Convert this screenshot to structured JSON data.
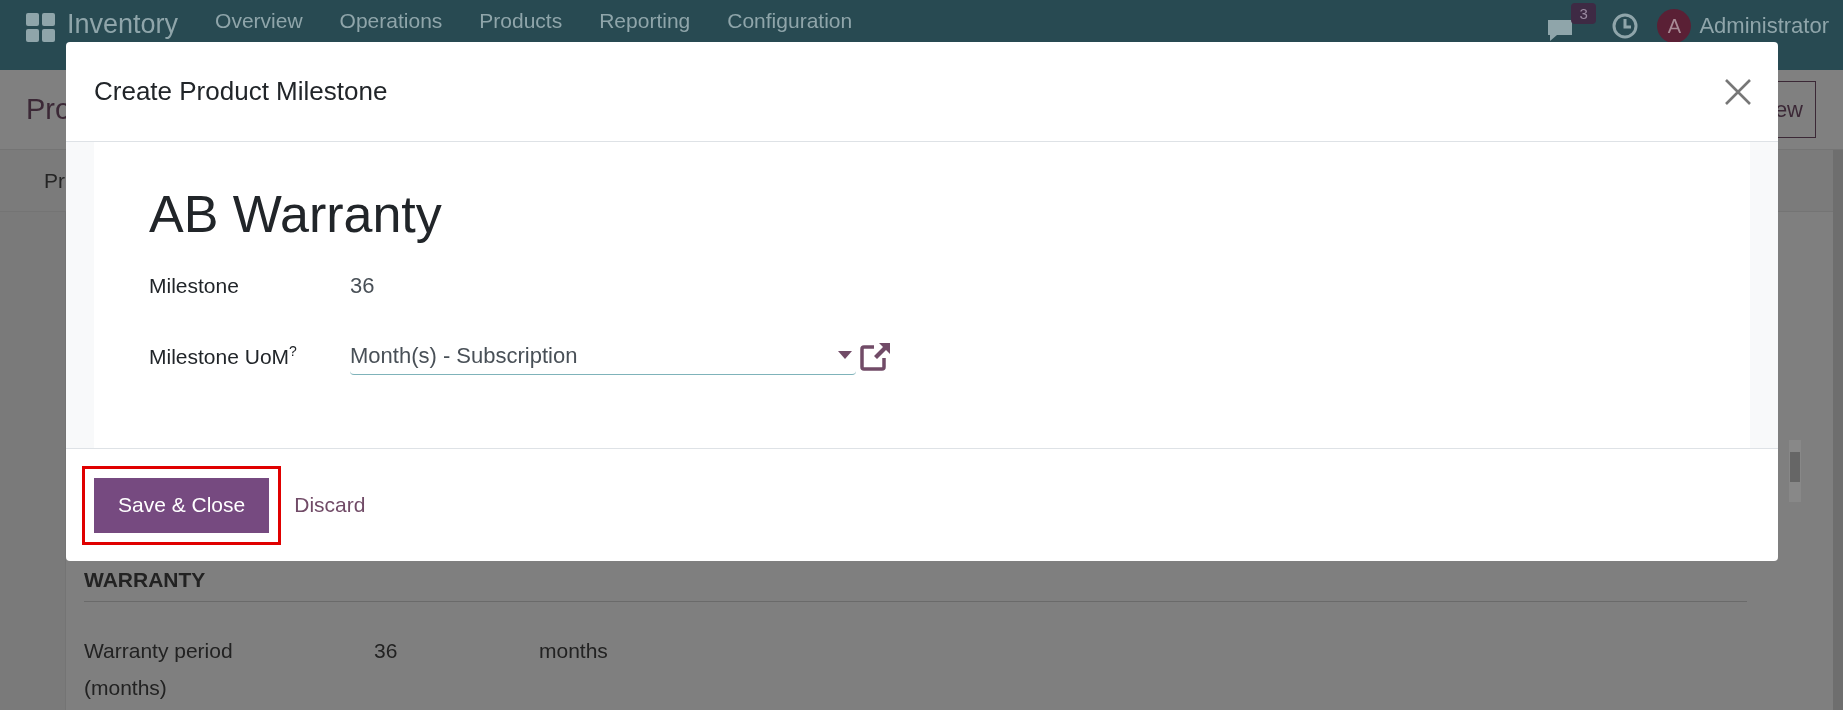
{
  "navbar": {
    "app_name": "Inventory",
    "menu": [
      "Overview",
      "Operations",
      "Products",
      "Reporting",
      "Configuration"
    ],
    "chat_count": "3",
    "avatar_letter": "A",
    "user": "Administrator"
  },
  "background": {
    "breadcrumb": "Pro",
    "button": "ew",
    "tab": "Pr",
    "section_title": "WARRANTY",
    "fields": [
      {
        "label": "Warranty period (months)",
        "value": "36",
        "unit": "months"
      }
    ]
  },
  "dialog": {
    "title": "Create Product Milestone",
    "record_name": "AB Warranty",
    "fields": [
      {
        "kind": "text",
        "label": "Milestone",
        "value": "36"
      },
      {
        "kind": "many2one",
        "label": "Milestone UoM$^{?}$",
        "value": "Month(s) - Subscription"
      }
    ],
    "buttons": [
      {
        "label": "Save & Close",
        "kind": "primary",
        "highlighted": true
      },
      {
        "label": "Discard",
        "kind": "link",
        "highlighted": false
      }
    ]
  }
}
